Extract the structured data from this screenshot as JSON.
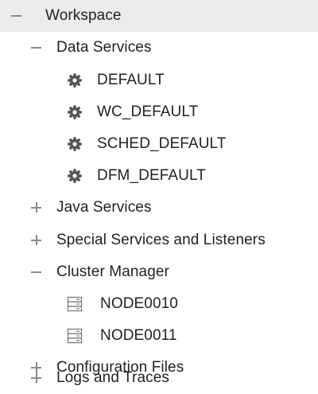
{
  "tree": {
    "workspace": {
      "label": "Workspace",
      "state": "expanded"
    },
    "data_services": {
      "label": "Data Services",
      "state": "expanded",
      "items": [
        "DEFAULT",
        "WC_DEFAULT",
        "SCHED_DEFAULT",
        "DFM_DEFAULT"
      ]
    },
    "java_services": {
      "label": "Java Services",
      "state": "collapsed"
    },
    "special_services": {
      "label": "Special Services and Listeners",
      "state": "collapsed"
    },
    "cluster_manager": {
      "label": "Cluster Manager",
      "state": "expanded",
      "nodes": [
        "NODE0010",
        "NODE0011"
      ]
    },
    "configuration_files": {
      "label": "Configuration Files",
      "state": "collapsed"
    },
    "logs_and_traces": {
      "label": "Logs and Traces",
      "state": "collapsed"
    }
  },
  "icons": {
    "service": "gear-icon",
    "node": "server-icon",
    "expanded": "minus-icon",
    "collapsed": "plus-icon"
  },
  "colors": {
    "selected_row_bg": "#ececec",
    "text": "#222222",
    "toggle": "#8a8a8a",
    "gear": "#555555",
    "server_icon": "#7a7a7a"
  }
}
